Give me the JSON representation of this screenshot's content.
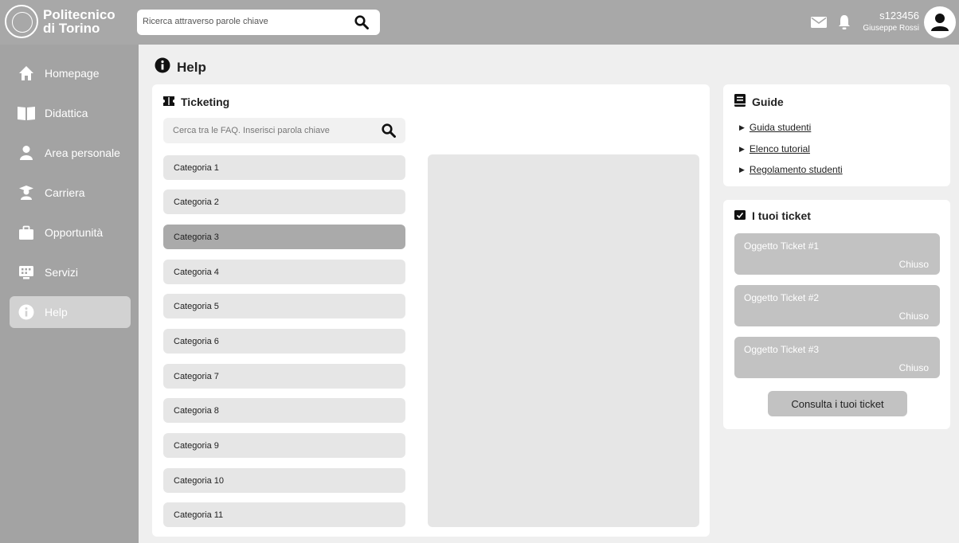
{
  "brand": {
    "line1": "Politecnico",
    "line2": "di Torino"
  },
  "top_search": {
    "placeholder": "Ricerca attraverso parole chiave"
  },
  "user": {
    "id": "s123456",
    "name": "Giuseppe Rossi"
  },
  "sidebar": {
    "items": [
      {
        "label": "Homepage",
        "icon": "home-icon"
      },
      {
        "label": "Didattica",
        "icon": "book-icon"
      },
      {
        "label": "Area personale",
        "icon": "person-icon"
      },
      {
        "label": "Carriera",
        "icon": "graduate-icon"
      },
      {
        "label": "Opportunità",
        "icon": "briefcase-icon"
      },
      {
        "label": "Servizi",
        "icon": "services-icon"
      },
      {
        "label": "Help",
        "icon": "info-icon",
        "active": true
      }
    ]
  },
  "page": {
    "title": "Help"
  },
  "ticketing": {
    "title": "Ticketing",
    "search_placeholder": "Cerca tra  le FAQ. Inserisci parola chiave",
    "categories": [
      "Categoria 1",
      "Categoria 2",
      "Categoria 3",
      "Categoria 4",
      "Categoria 5",
      "Categoria 6",
      "Categoria 7",
      "Categoria 8",
      "Categoria 9",
      "Categoria 10",
      "Categoria 11"
    ],
    "selected_category": "Categoria 3"
  },
  "guide": {
    "title": "Guide",
    "links": [
      "Guida studenti",
      "Elenco tutorial",
      "Regolamento studenti"
    ]
  },
  "tickets": {
    "title": "I tuoi ticket",
    "items": [
      {
        "subject": "Oggetto Ticket #1",
        "status": "Chiuso"
      },
      {
        "subject": "Oggetto Ticket #2",
        "status": "Chiuso"
      },
      {
        "subject": "Oggetto Ticket #3",
        "status": "Chiuso"
      }
    ],
    "button_label": "Consulta i tuoi ticket"
  }
}
